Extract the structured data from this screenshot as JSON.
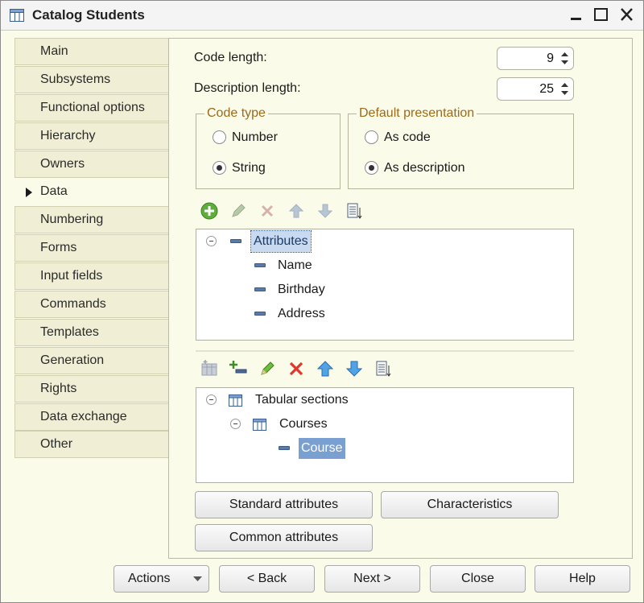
{
  "window": {
    "title": "Catalog Students",
    "icons": {
      "app": "table-icon",
      "minimize": "minimize-icon",
      "maximize": "maximize-icon",
      "close": "close-icon"
    }
  },
  "nav": {
    "items": [
      {
        "label": "Main"
      },
      {
        "label": "Subsystems"
      },
      {
        "label": "Functional options"
      },
      {
        "label": "Hierarchy"
      },
      {
        "label": "Owners"
      },
      {
        "label": "Data",
        "active": true
      },
      {
        "label": "Numbering"
      },
      {
        "label": "Forms"
      },
      {
        "label": "Input fields"
      },
      {
        "label": "Commands"
      },
      {
        "label": "Templates"
      },
      {
        "label": "Generation"
      },
      {
        "label": "Rights"
      },
      {
        "label": "Data exchange"
      },
      {
        "label": "Other"
      }
    ]
  },
  "form": {
    "code_length_label": "Code length:",
    "code_length_value": "9",
    "description_length_label": "Description length:",
    "description_length_value": "25",
    "code_type": {
      "title": "Code type",
      "options": [
        {
          "label": "Number",
          "checked": false
        },
        {
          "label": "String",
          "checked": true
        }
      ]
    },
    "default_presentation": {
      "title": "Default presentation",
      "options": [
        {
          "label": "As code",
          "checked": false
        },
        {
          "label": "As description",
          "checked": true
        }
      ]
    }
  },
  "attributes_toolbar": [
    "add-icon",
    "edit-icon",
    "delete-icon",
    "move-up-icon",
    "move-down-icon",
    "sort-list-icon"
  ],
  "attributes_tree": {
    "root": "Attributes",
    "children": [
      "Name",
      "Birthday",
      "Address"
    ]
  },
  "tabular_toolbar": [
    "add-tabular-section-icon",
    "add-attribute-icon",
    "edit-icon",
    "delete-icon",
    "move-up-icon",
    "move-down-icon",
    "sort-list-icon"
  ],
  "tabular_tree": {
    "root": "Tabular sections",
    "section": "Courses",
    "attribute": "Course"
  },
  "buttons": {
    "standard_attributes": "Standard attributes",
    "characteristics": "Characteristics",
    "common_attributes": "Common attributes"
  },
  "footer": {
    "actions": "Actions",
    "back": "< Back",
    "next": "Next >",
    "close": "Close",
    "help": "Help"
  },
  "colors": {
    "background": "#fbfbe9",
    "group_title": "#9c6a1a",
    "selection": "#7aa0d2"
  }
}
